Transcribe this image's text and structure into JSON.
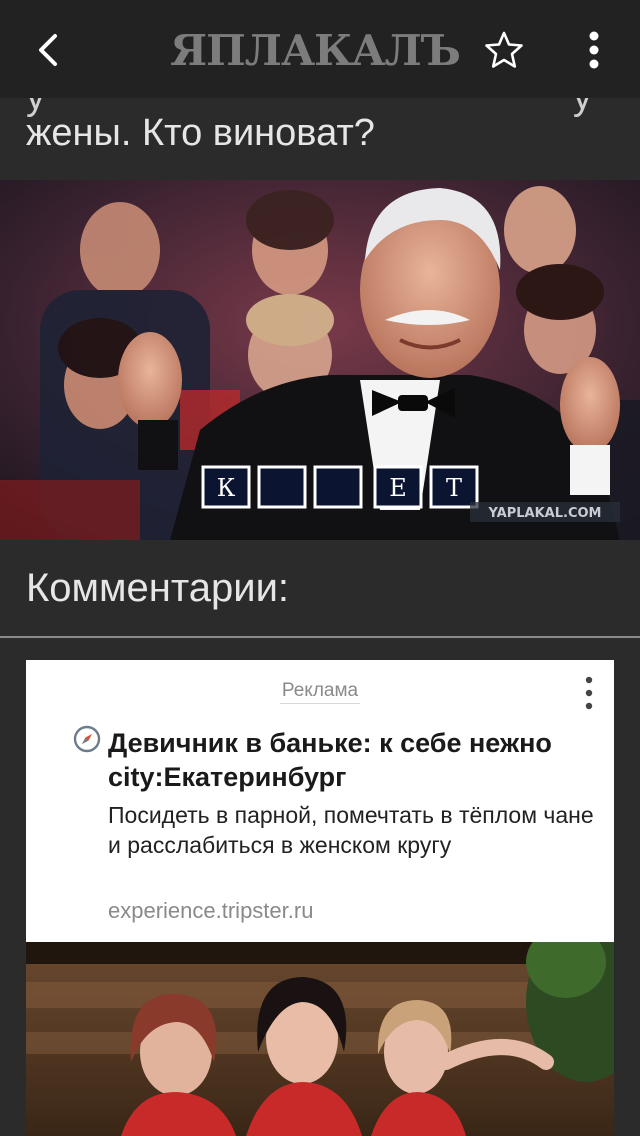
{
  "header": {
    "back_icon": "chevron-left-icon",
    "logo_text": "ЯПЛАКАЛЪ",
    "favorite_icon": "star-outline-icon",
    "menu_icon": "kebab-menu-icon"
  },
  "post": {
    "title_line": "жены. Кто виноват?",
    "image": {
      "alt": "Ведущий в смокинге аплодирует на фоне зрителей",
      "letter_tiles": [
        "К",
        "",
        "",
        "Е",
        "Т"
      ],
      "watermark": "YAPLAKAL.COM"
    }
  },
  "comments": {
    "heading": "Комментарии:"
  },
  "ad": {
    "label": "Реклама",
    "menu_icon": "kebab-menu-icon",
    "compass_icon": "compass-icon",
    "headline": "Девичник в баньке: к себе нежно city:Екатеринбург",
    "description": "Посидеть в парной, помечтать в тёплом чане и расслабиться в женском кругу",
    "domain": "experience.tripster.ru"
  },
  "colors": {
    "background": "#2b2b2b",
    "topbar": "#222222",
    "logo": "#7c7c7c",
    "text": "#e6e6e6",
    "ad_card": "#ffffff",
    "ad_domain": "#8a8a8a"
  }
}
